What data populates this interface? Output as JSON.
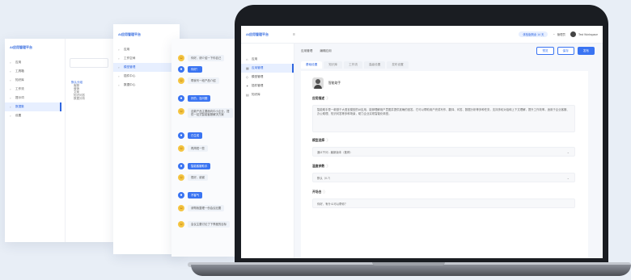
{
  "panel1": {
    "app_title": "AI应用管理平台",
    "nav": [
      "应用",
      "工具箱",
      "知识库",
      "工作流",
      "提示词",
      "数据集",
      "设置"
    ],
    "active_index": 5,
    "tree": [
      "默认分组",
      "客服",
      "营销",
      "文案",
      "知识问答",
      "数据分析"
    ]
  },
  "panel2": {
    "app_title": "AI应用管理平台",
    "nav": [
      "应用",
      "工作空间",
      "模型管理",
      "插件中心",
      "数据中心"
    ],
    "active_index": 2
  },
  "panel3": {
    "chats": [
      {
        "avatar": "user",
        "text": "你好，请介绍一下你自己",
        "style": "plain"
      },
      {
        "avatar": "bot",
        "text": "你好！",
        "style": "blue"
      },
      {
        "avatar": "user",
        "text": "帮我写一段产品介绍",
        "style": "plain"
      },
      {
        "avatar": "bot",
        "text": "好的，没问题",
        "style": "blue"
      },
      {
        "avatar": "user",
        "text": "这款产品主要面向中小企业，提供一站式智能客服解决方案",
        "style": "plain"
      },
      {
        "avatar": "bot",
        "text": "已生成",
        "style": "blue"
      },
      {
        "avatar": "user",
        "text": "再简短一些",
        "style": "plain"
      },
      {
        "avatar": "bot",
        "text": "智能客服助手",
        "style": "blue"
      },
      {
        "avatar": "user",
        "text": "很好，谢谢",
        "style": "plain"
      },
      {
        "avatar": "bot",
        "text": "不客气",
        "style": "blue"
      },
      {
        "avatar": "user",
        "text": "请帮我整理一份会议纪要",
        "style": "plain"
      },
      {
        "avatar": "user",
        "text": "会议主要讨论了下季度的目标",
        "style": "plain"
      }
    ]
  },
  "laptop": {
    "app_title": "AI应用管理平台",
    "topbar": {
      "status_pill": "体验版剩余 14 天",
      "user_name": "管理员",
      "workspace": "Test Workspace"
    },
    "sidebar": [
      "应用",
      "应用管理",
      "模型管理",
      "插件管理",
      "知识库"
    ],
    "active_index": 1,
    "header_title": "应用管理",
    "header_subtitle": "编辑应用",
    "buttons": {
      "preview": "预览",
      "save": "保存",
      "publish": "发布"
    },
    "tabs": [
      "基础设置",
      "知识库",
      "工作流",
      "高级设置",
      "发布设置"
    ],
    "active_tab": 0,
    "app_name": "智能助手",
    "fields": {
      "intro_label": "应用描述",
      "intro_text": "智能助手是一款基于大语言模型的AI应用，能够理解用户意图并提供准确的回答。它可以帮助用户完成写作、翻译、问答、数据分析等多种任务，支持多轮对话和上下文理解，提升工作效率。适用于企业客服、办公助理、知识问答等多种场景，助力企业实现智能化转型。",
      "model_label": "模型选择",
      "model_value": "通义千问 - 最新版本（推荐）",
      "temp_label": "温度参数",
      "temp_value": "默认（0.7）",
      "prompt_label": "开场白",
      "prompt_value": "你好，有什么可以帮你？"
    }
  }
}
